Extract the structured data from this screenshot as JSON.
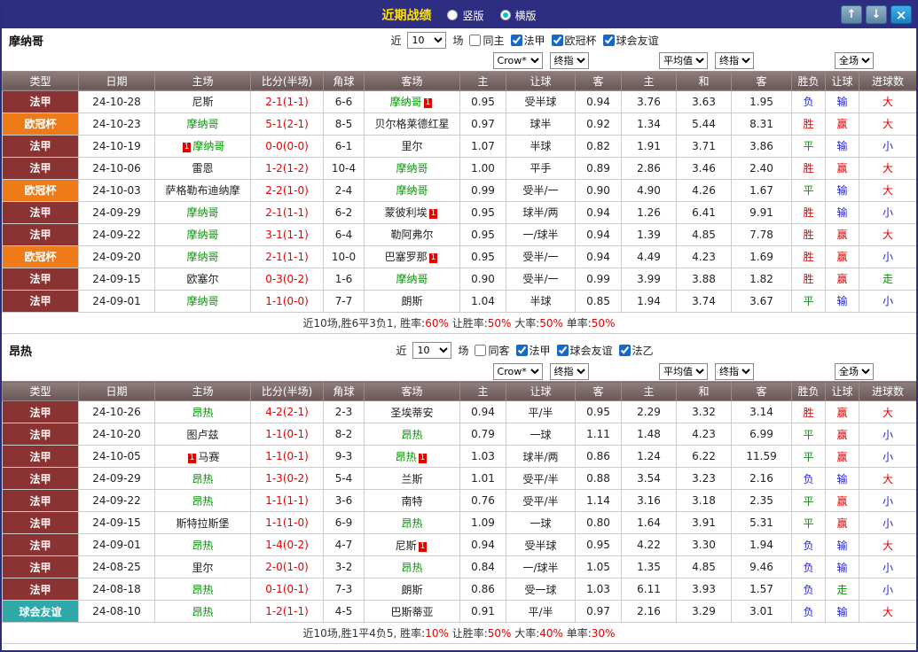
{
  "titlebar": {
    "title": "近期战绩",
    "radios": [
      {
        "label": "竖版",
        "selected": false
      },
      {
        "label": "横版",
        "selected": true
      }
    ],
    "buttons": {
      "up": "↑",
      "down": "↓",
      "close": "×"
    }
  },
  "columns": [
    "类型",
    "日期",
    "主场",
    "比分(半场)",
    "角球",
    "客场",
    "主",
    "让球",
    "客",
    "主",
    "和",
    "客",
    "胜负",
    "让球",
    "进球数"
  ],
  "filter_selects": {
    "asian": [
      "Crow*",
      "终指"
    ],
    "euro": [
      "平均值",
      "终指"
    ],
    "outcome": [
      "全场"
    ]
  },
  "league_colors": {
    "法甲": "#8b3232",
    "欧冠杯": "#ee7b18",
    "球会友谊": "#2fa8a8"
  },
  "result_colors": {
    "red": "#e60000",
    "green": "#009900",
    "blue": "#2222dd"
  },
  "sections": [
    {
      "team": "摩纳哥",
      "near_label": "近",
      "count": "10",
      "unit_label": "场",
      "checkboxes": [
        {
          "label": "同主",
          "checked": false
        },
        {
          "label": "法甲",
          "checked": true
        },
        {
          "label": "欧冠杯",
          "checked": true
        },
        {
          "label": "球会友谊",
          "checked": true
        }
      ],
      "rows": [
        {
          "league": "法甲",
          "date": "24-10-28",
          "home": {
            "name": "尼斯",
            "focus": false,
            "red_card": ""
          },
          "score": "2-1(1-1)",
          "corners": "6-6",
          "away": {
            "name": "摩纳哥",
            "focus": true,
            "red_card": "1"
          },
          "asian": [
            "0.95",
            "受半球",
            "0.94"
          ],
          "euro": [
            "3.76",
            "3.63",
            "1.95"
          ],
          "outcome": [
            {
              "t": "负",
              "c": "blue"
            },
            {
              "t": "输",
              "c": "blue"
            },
            {
              "t": "大",
              "c": "red"
            }
          ]
        },
        {
          "league": "欧冠杯",
          "date": "24-10-23",
          "home": {
            "name": "摩纳哥",
            "focus": true,
            "red_card": ""
          },
          "score": "5-1(2-1)",
          "corners": "8-5",
          "away": {
            "name": "贝尔格莱德红星",
            "focus": false,
            "red_card": ""
          },
          "asian": [
            "0.97",
            "球半",
            "0.92"
          ],
          "euro": [
            "1.34",
            "5.44",
            "8.31"
          ],
          "outcome": [
            {
              "t": "胜",
              "c": "red"
            },
            {
              "t": "赢",
              "c": "red"
            },
            {
              "t": "大",
              "c": "red"
            }
          ]
        },
        {
          "league": "法甲",
          "date": "24-10-19",
          "home": {
            "name": "摩纳哥",
            "focus": true,
            "red_card": "1"
          },
          "score": "0-0(0-0)",
          "corners": "6-1",
          "away": {
            "name": "里尔",
            "focus": false,
            "red_card": ""
          },
          "asian": [
            "1.07",
            "半球",
            "0.82"
          ],
          "euro": [
            "1.91",
            "3.71",
            "3.86"
          ],
          "outcome": [
            {
              "t": "平",
              "c": "green"
            },
            {
              "t": "输",
              "c": "blue"
            },
            {
              "t": "小",
              "c": "blue"
            }
          ]
        },
        {
          "league": "法甲",
          "date": "24-10-06",
          "home": {
            "name": "雷恩",
            "focus": false,
            "red_card": ""
          },
          "score": "1-2(1-2)",
          "corners": "10-4",
          "away": {
            "name": "摩纳哥",
            "focus": true,
            "red_card": ""
          },
          "asian": [
            "1.00",
            "平手",
            "0.89"
          ],
          "euro": [
            "2.86",
            "3.46",
            "2.40"
          ],
          "outcome": [
            {
              "t": "胜",
              "c": "red"
            },
            {
              "t": "赢",
              "c": "red"
            },
            {
              "t": "大",
              "c": "red"
            }
          ]
        },
        {
          "league": "欧冠杯",
          "date": "24-10-03",
          "home": {
            "name": "萨格勒布迪纳摩",
            "focus": false,
            "red_card": ""
          },
          "score": "2-2(1-0)",
          "corners": "2-4",
          "away": {
            "name": "摩纳哥",
            "focus": true,
            "red_card": ""
          },
          "asian": [
            "0.99",
            "受半/一",
            "0.90"
          ],
          "euro": [
            "4.90",
            "4.26",
            "1.67"
          ],
          "outcome": [
            {
              "t": "平",
              "c": "green"
            },
            {
              "t": "输",
              "c": "blue"
            },
            {
              "t": "大",
              "c": "red"
            }
          ]
        },
        {
          "league": "法甲",
          "date": "24-09-29",
          "home": {
            "name": "摩纳哥",
            "focus": true,
            "red_card": ""
          },
          "score": "2-1(1-1)",
          "corners": "6-2",
          "away": {
            "name": "蒙彼利埃",
            "focus": false,
            "red_card": "1"
          },
          "asian": [
            "0.95",
            "球半/两",
            "0.94"
          ],
          "euro": [
            "1.26",
            "6.41",
            "9.91"
          ],
          "outcome": [
            {
              "t": "胜",
              "c": "red"
            },
            {
              "t": "输",
              "c": "blue"
            },
            {
              "t": "小",
              "c": "blue"
            }
          ]
        },
        {
          "league": "法甲",
          "date": "24-09-22",
          "home": {
            "name": "摩纳哥",
            "focus": true,
            "red_card": ""
          },
          "score": "3-1(1-1)",
          "corners": "6-4",
          "away": {
            "name": "勒阿弗尔",
            "focus": false,
            "red_card": ""
          },
          "asian": [
            "0.95",
            "一/球半",
            "0.94"
          ],
          "euro": [
            "1.39",
            "4.85",
            "7.78"
          ],
          "outcome": [
            {
              "t": "胜",
              "c": "red"
            },
            {
              "t": "赢",
              "c": "red"
            },
            {
              "t": "大",
              "c": "red"
            }
          ]
        },
        {
          "league": "欧冠杯",
          "date": "24-09-20",
          "home": {
            "name": "摩纳哥",
            "focus": true,
            "red_card": ""
          },
          "score": "2-1(1-1)",
          "corners": "10-0",
          "away": {
            "name": "巴塞罗那",
            "focus": false,
            "red_card": "1"
          },
          "asian": [
            "0.95",
            "受半/一",
            "0.94"
          ],
          "euro": [
            "4.49",
            "4.23",
            "1.69"
          ],
          "outcome": [
            {
              "t": "胜",
              "c": "red"
            },
            {
              "t": "赢",
              "c": "red"
            },
            {
              "t": "小",
              "c": "blue"
            }
          ]
        },
        {
          "league": "法甲",
          "date": "24-09-15",
          "home": {
            "name": "欧塞尔",
            "focus": false,
            "red_card": ""
          },
          "score": "0-3(0-2)",
          "corners": "1-6",
          "away": {
            "name": "摩纳哥",
            "focus": true,
            "red_card": ""
          },
          "asian": [
            "0.90",
            "受半/一",
            "0.99"
          ],
          "euro": [
            "3.99",
            "3.88",
            "1.82"
          ],
          "outcome": [
            {
              "t": "胜",
              "c": "red"
            },
            {
              "t": "赢",
              "c": "red"
            },
            {
              "t": "走",
              "c": "green"
            }
          ]
        },
        {
          "league": "法甲",
          "date": "24-09-01",
          "home": {
            "name": "摩纳哥",
            "focus": true,
            "red_card": ""
          },
          "score": "1-1(0-0)",
          "corners": "7-7",
          "away": {
            "name": "朗斯",
            "focus": false,
            "red_card": ""
          },
          "asian": [
            "1.04",
            "半球",
            "0.85"
          ],
          "euro": [
            "1.94",
            "3.74",
            "3.67"
          ],
          "outcome": [
            {
              "t": "平",
              "c": "green"
            },
            {
              "t": "输",
              "c": "blue"
            },
            {
              "t": "小",
              "c": "blue"
            }
          ]
        }
      ],
      "summary": [
        {
          "text": "近10场,胜6平3负1, 胜率:",
          "color": "#333333"
        },
        {
          "text": "60%",
          "color": "#e60000"
        },
        {
          "text": " 让胜率:",
          "color": "#333333"
        },
        {
          "text": "50%",
          "color": "#e60000"
        },
        {
          "text": " 大率:",
          "color": "#333333"
        },
        {
          "text": "50%",
          "color": "#e60000"
        },
        {
          "text": " 单率:",
          "color": "#333333"
        },
        {
          "text": "50%",
          "color": "#e60000"
        }
      ]
    },
    {
      "team": "昂热",
      "near_label": "近",
      "count": "10",
      "unit_label": "场",
      "checkboxes": [
        {
          "label": "同客",
          "checked": false
        },
        {
          "label": "法甲",
          "checked": true
        },
        {
          "label": "球会友谊",
          "checked": true
        },
        {
          "label": "法乙",
          "checked": true
        }
      ],
      "rows": [
        {
          "league": "法甲",
          "date": "24-10-26",
          "home": {
            "name": "昂热",
            "focus": true,
            "red_card": ""
          },
          "score": "4-2(2-1)",
          "corners": "2-3",
          "away": {
            "name": "圣埃蒂安",
            "focus": false,
            "red_card": ""
          },
          "asian": [
            "0.94",
            "平/半",
            "0.95"
          ],
          "euro": [
            "2.29",
            "3.32",
            "3.14"
          ],
          "outcome": [
            {
              "t": "胜",
              "c": "red"
            },
            {
              "t": "赢",
              "c": "red"
            },
            {
              "t": "大",
              "c": "red"
            }
          ]
        },
        {
          "league": "法甲",
          "date": "24-10-20",
          "home": {
            "name": "图卢兹",
            "focus": false,
            "red_card": ""
          },
          "score": "1-1(0-1)",
          "corners": "8-2",
          "away": {
            "name": "昂热",
            "focus": true,
            "red_card": ""
          },
          "asian": [
            "0.79",
            "一球",
            "1.11"
          ],
          "euro": [
            "1.48",
            "4.23",
            "6.99"
          ],
          "outcome": [
            {
              "t": "平",
              "c": "green"
            },
            {
              "t": "赢",
              "c": "red"
            },
            {
              "t": "小",
              "c": "blue"
            }
          ]
        },
        {
          "league": "法甲",
          "date": "24-10-05",
          "home": {
            "name": "马赛",
            "focus": false,
            "red_card": "1"
          },
          "score": "1-1(0-1)",
          "corners": "9-3",
          "away": {
            "name": "昂热",
            "focus": true,
            "red_card": "1"
          },
          "asian": [
            "1.03",
            "球半/两",
            "0.86"
          ],
          "euro": [
            "1.24",
            "6.22",
            "11.59"
          ],
          "outcome": [
            {
              "t": "平",
              "c": "green"
            },
            {
              "t": "赢",
              "c": "red"
            },
            {
              "t": "小",
              "c": "blue"
            }
          ]
        },
        {
          "league": "法甲",
          "date": "24-09-29",
          "home": {
            "name": "昂热",
            "focus": true,
            "red_card": ""
          },
          "score": "1-3(0-2)",
          "corners": "5-4",
          "away": {
            "name": "兰斯",
            "focus": false,
            "red_card": ""
          },
          "asian": [
            "1.01",
            "受平/半",
            "0.88"
          ],
          "euro": [
            "3.54",
            "3.23",
            "2.16"
          ],
          "outcome": [
            {
              "t": "负",
              "c": "blue"
            },
            {
              "t": "输",
              "c": "blue"
            },
            {
              "t": "大",
              "c": "red"
            }
          ]
        },
        {
          "league": "法甲",
          "date": "24-09-22",
          "home": {
            "name": "昂热",
            "focus": true,
            "red_card": ""
          },
          "score": "1-1(1-1)",
          "corners": "3-6",
          "away": {
            "name": "南特",
            "focus": false,
            "red_card": ""
          },
          "asian": [
            "0.76",
            "受平/半",
            "1.14"
          ],
          "euro": [
            "3.16",
            "3.18",
            "2.35"
          ],
          "outcome": [
            {
              "t": "平",
              "c": "green"
            },
            {
              "t": "赢",
              "c": "red"
            },
            {
              "t": "小",
              "c": "blue"
            }
          ]
        },
        {
          "league": "法甲",
          "date": "24-09-15",
          "home": {
            "name": "斯特拉斯堡",
            "focus": false,
            "red_card": ""
          },
          "score": "1-1(1-0)",
          "corners": "6-9",
          "away": {
            "name": "昂热",
            "focus": true,
            "red_card": ""
          },
          "asian": [
            "1.09",
            "一球",
            "0.80"
          ],
          "euro": [
            "1.64",
            "3.91",
            "5.31"
          ],
          "outcome": [
            {
              "t": "平",
              "c": "green"
            },
            {
              "t": "赢",
              "c": "red"
            },
            {
              "t": "小",
              "c": "blue"
            }
          ]
        },
        {
          "league": "法甲",
          "date": "24-09-01",
          "home": {
            "name": "昂热",
            "focus": true,
            "red_card": ""
          },
          "score": "1-4(0-2)",
          "corners": "4-7",
          "away": {
            "name": "尼斯",
            "focus": false,
            "red_card": "1"
          },
          "asian": [
            "0.94",
            "受半球",
            "0.95"
          ],
          "euro": [
            "4.22",
            "3.30",
            "1.94"
          ],
          "outcome": [
            {
              "t": "负",
              "c": "blue"
            },
            {
              "t": "输",
              "c": "blue"
            },
            {
              "t": "大",
              "c": "red"
            }
          ]
        },
        {
          "league": "法甲",
          "date": "24-08-25",
          "home": {
            "name": "里尔",
            "focus": false,
            "red_card": ""
          },
          "score": "2-0(1-0)",
          "corners": "3-2",
          "away": {
            "name": "昂热",
            "focus": true,
            "red_card": ""
          },
          "asian": [
            "0.84",
            "一/球半",
            "1.05"
          ],
          "euro": [
            "1.35",
            "4.85",
            "9.46"
          ],
          "outcome": [
            {
              "t": "负",
              "c": "blue"
            },
            {
              "t": "输",
              "c": "blue"
            },
            {
              "t": "小",
              "c": "blue"
            }
          ]
        },
        {
          "league": "法甲",
          "date": "24-08-18",
          "home": {
            "name": "昂热",
            "focus": true,
            "red_card": ""
          },
          "score": "0-1(0-1)",
          "corners": "7-3",
          "away": {
            "name": "朗斯",
            "focus": false,
            "red_card": ""
          },
          "asian": [
            "0.86",
            "受一球",
            "1.03"
          ],
          "euro": [
            "6.11",
            "3.93",
            "1.57"
          ],
          "outcome": [
            {
              "t": "负",
              "c": "blue"
            },
            {
              "t": "走",
              "c": "green"
            },
            {
              "t": "小",
              "c": "blue"
            }
          ]
        },
        {
          "league": "球会友谊",
          "date": "24-08-10",
          "home": {
            "name": "昂热",
            "focus": true,
            "red_card": ""
          },
          "score": "1-2(1-1)",
          "corners": "4-5",
          "away": {
            "name": "巴斯蒂亚",
            "focus": false,
            "red_card": ""
          },
          "asian": [
            "0.91",
            "平/半",
            "0.97"
          ],
          "euro": [
            "2.16",
            "3.29",
            "3.01"
          ],
          "outcome": [
            {
              "t": "负",
              "c": "blue"
            },
            {
              "t": "输",
              "c": "blue"
            },
            {
              "t": "大",
              "c": "red"
            }
          ]
        }
      ],
      "summary": [
        {
          "text": "近10场,胜1平4负5, 胜率:",
          "color": "#333333"
        },
        {
          "text": "10%",
          "color": "#e60000"
        },
        {
          "text": " 让胜率:",
          "color": "#333333"
        },
        {
          "text": "50%",
          "color": "#e60000"
        },
        {
          "text": " 大率:",
          "color": "#333333"
        },
        {
          "text": "40%",
          "color": "#e60000"
        },
        {
          "text": " 单率:",
          "color": "#333333"
        },
        {
          "text": "30%",
          "color": "#e60000"
        }
      ]
    }
  ]
}
